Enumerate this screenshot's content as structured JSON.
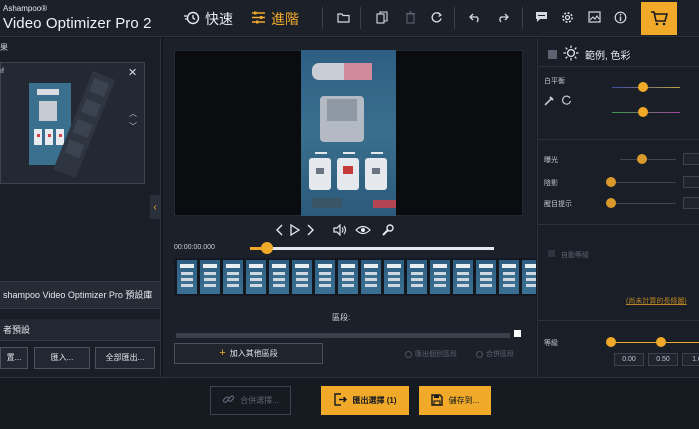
{
  "app": {
    "brand_small": "Ashampoo®",
    "brand_big": "Video Optimizer Pro 2"
  },
  "modes": {
    "fast": "快速",
    "advanced": "進階"
  },
  "toolbar_icons": [
    "folder-icon",
    "copy-icon",
    "delete-icon",
    "refresh-icon",
    "undo-icon",
    "redo-icon",
    "message-icon",
    "gear-icon",
    "picture-icon",
    "info-icon",
    "cart-icon"
  ],
  "left_panel": {
    "tab_mark": "果",
    "card_tag": "ıf",
    "preset_library": "shampoo Video Optimizer Pro 預設庫",
    "user_presets": "者預設",
    "buttons": [
      "置...",
      "匯入...",
      "全部匯出..."
    ]
  },
  "player": {
    "timecode": "00:00:00.000",
    "progress_fraction": 0.07,
    "frames_count": 16
  },
  "segments": {
    "label": "區段:",
    "add_button": "加入其他區段",
    "export_segments": "匯出個別區段",
    "merge_segments": "合併區段"
  },
  "right_panel": {
    "header": "範例, 色彩",
    "white_balance": "白平衡",
    "exposure": "曝光",
    "shadows": "陰影",
    "highlights": "醒目提示",
    "auto_level": "自動等級",
    "link_text": "(尚未計算的長條圖)",
    "level": "等級",
    "scale": [
      "0.00",
      "0.50",
      "1.0"
    ],
    "accent": "#f0a928"
  },
  "bottom": {
    "merge_button": "合併選擇...",
    "export_button": "匯出選擇 (1)",
    "save_button": "儲存到..."
  }
}
